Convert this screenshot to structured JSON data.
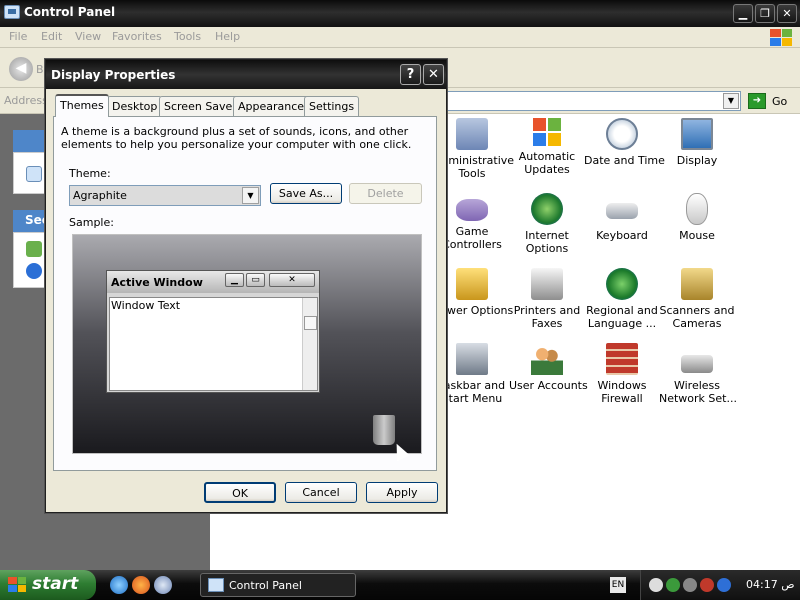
{
  "control_panel": {
    "title": "Control Panel",
    "menu": [
      "File",
      "Edit",
      "View",
      "Favorites",
      "Tools",
      "Help"
    ],
    "back_label": "Back",
    "address_label": "Address",
    "go_label": "Go",
    "left_panel": {
      "see_also_header": "See"
    },
    "items": [
      {
        "label": "Administrative\nTools",
        "icon": "admin-tools-icon"
      },
      {
        "label": "Automatic\nUpdates",
        "icon": "windows-update-icon"
      },
      {
        "label": "Date and Time",
        "icon": "clock-icon"
      },
      {
        "label": "Display",
        "icon": "display-icon"
      },
      {
        "label": "Game\nControllers",
        "icon": "gamepad-icon"
      },
      {
        "label": "Internet\nOptions",
        "icon": "globe-icon"
      },
      {
        "label": "Keyboard",
        "icon": "keyboard-icon"
      },
      {
        "label": "Mouse",
        "icon": "mouse-icon"
      },
      {
        "label": "Power Options",
        "icon": "power-icon"
      },
      {
        "label": "Printers and\nFaxes",
        "icon": "printer-icon"
      },
      {
        "label": "Regional and\nLanguage ...",
        "icon": "regional-globe-icon"
      },
      {
        "label": "Scanners and\nCameras",
        "icon": "scanner-icon"
      },
      {
        "label": "Taskbar and\nStart Menu",
        "icon": "taskbar-icon"
      },
      {
        "label": "User Accounts",
        "icon": "users-icon"
      },
      {
        "label": "Windows\nFirewall",
        "icon": "firewall-icon"
      },
      {
        "label": "Wireless\nNetwork Set...",
        "icon": "wireless-icon"
      }
    ]
  },
  "dialog": {
    "title": "Display Properties",
    "help_label": "?",
    "close_label": "✕",
    "tabs": [
      "Themes",
      "Desktop",
      "Screen Saver",
      "Appearance",
      "Settings"
    ],
    "description": "A theme is a background plus a set of sounds, icons, and other elements to help you personalize your computer with one click.",
    "theme_label": "Theme:",
    "theme_value": "Agraphite",
    "save_as_label": "Save As...",
    "delete_label": "Delete",
    "sample_label": "Sample:",
    "sample_window": {
      "title": "Active Window",
      "text": "Window Text"
    },
    "ok_label": "OK",
    "cancel_label": "Cancel",
    "apply_label": "Apply"
  },
  "taskbar": {
    "start_label": "start",
    "task_label": "Control Panel",
    "language": "EN",
    "clock": "04:17 ﺹ"
  }
}
